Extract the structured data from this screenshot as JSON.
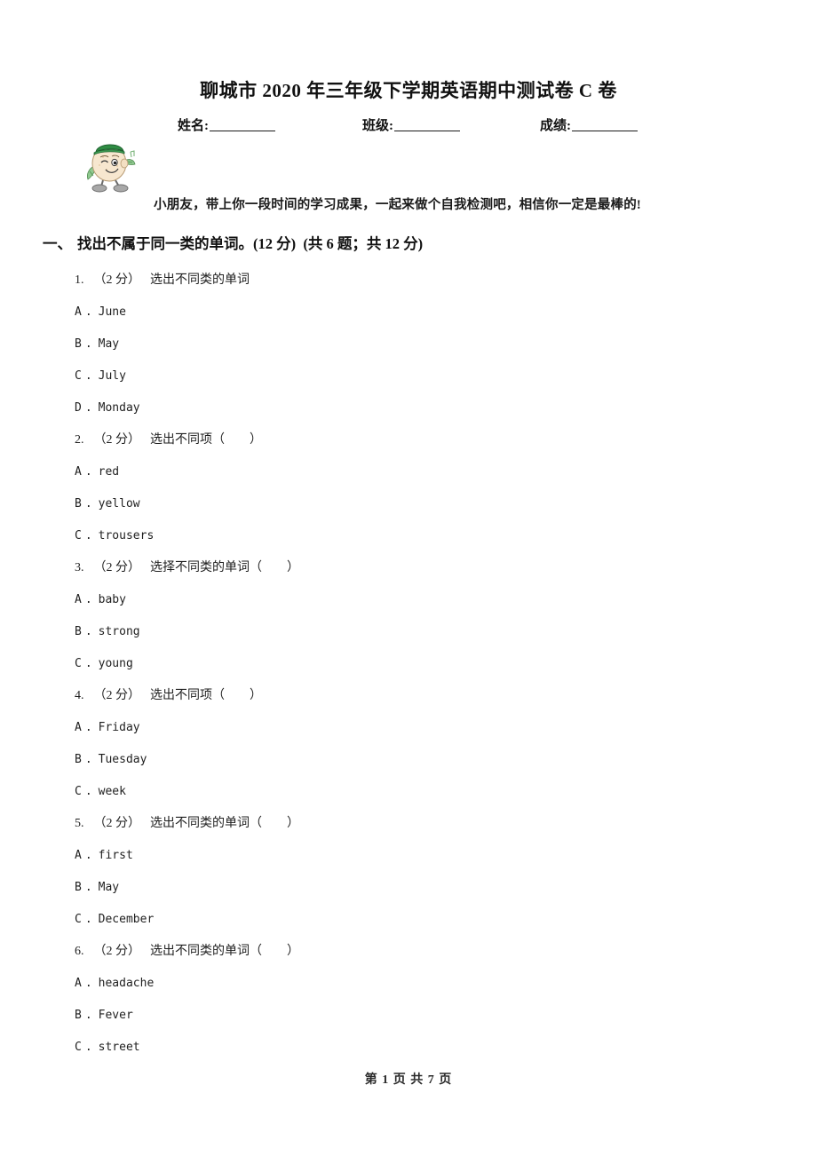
{
  "document": {
    "title": "聊城市 2020 年三年级下学期英语期中测试卷 C 卷",
    "encouragement": "小朋友，带上你一段时间的学习成果，一起来做个自我检测吧，相信你一定是最棒的!",
    "footer": "第 1 页 共 7 页",
    "page_current": "1",
    "page_total": "7"
  },
  "identity": {
    "name_label": "姓名:",
    "class_label": "班级:",
    "score_label": "成绩:",
    "name_value": "",
    "class_value": "",
    "score_value": ""
  },
  "mascot": {
    "icon_name": "cartoon-mascot-icon",
    "hat_color": "#2e8b3f",
    "face_color": "#f6e3c8",
    "leaf_color": "#7dbb7d",
    "shoe_color": "#9a9a9a"
  },
  "section": {
    "number": "一、",
    "title": "找出不属于同一类的单词。(12 分)",
    "meta": "(共 6 题；共 12 分)"
  },
  "questions": [
    {
      "index": "1.",
      "points": "（2 分）",
      "stem": "选出不同类的单词",
      "options": [
        {
          "letter": "A",
          "dot": ".",
          "text": "June"
        },
        {
          "letter": "B",
          "dot": ".",
          "text": "May"
        },
        {
          "letter": "C",
          "dot": ".",
          "text": "July"
        },
        {
          "letter": "D",
          "dot": ".",
          "text": "Monday"
        }
      ]
    },
    {
      "index": "2.",
      "points": "（2 分）",
      "stem": "选出不同项（　　）",
      "options": [
        {
          "letter": "A",
          "dot": ".",
          "text": "red"
        },
        {
          "letter": "B",
          "dot": ".",
          "text": "yellow"
        },
        {
          "letter": "C",
          "dot": ".",
          "text": "trousers"
        }
      ]
    },
    {
      "index": "3.",
      "points": "（2 分）",
      "stem": "选择不同类的单词（　　）",
      "options": [
        {
          "letter": "A",
          "dot": ".",
          "text": "baby"
        },
        {
          "letter": "B",
          "dot": ".",
          "text": "strong"
        },
        {
          "letter": "C",
          "dot": ".",
          "text": "young"
        }
      ]
    },
    {
      "index": "4.",
      "points": "（2 分）",
      "stem": "选出不同项（　　）",
      "options": [
        {
          "letter": "A",
          "dot": ".",
          "text": "Friday"
        },
        {
          "letter": "B",
          "dot": ".",
          "text": "Tuesday"
        },
        {
          "letter": "C",
          "dot": ".",
          "text": "week"
        }
      ]
    },
    {
      "index": "5.",
      "points": "（2 分）",
      "stem": "选出不同类的单词（　　）",
      "options": [
        {
          "letter": "A",
          "dot": ".",
          "text": "first"
        },
        {
          "letter": "B",
          "dot": ".",
          "text": "May"
        },
        {
          "letter": "C",
          "dot": ".",
          "text": "December"
        }
      ]
    },
    {
      "index": "6.",
      "points": "（2 分）",
      "stem": "选出不同类的单词（　　）",
      "options": [
        {
          "letter": "A",
          "dot": ".",
          "text": "headache"
        },
        {
          "letter": "B",
          "dot": ".",
          "text": "Fever"
        },
        {
          "letter": "C",
          "dot": ".",
          "text": "street"
        }
      ]
    }
  ]
}
